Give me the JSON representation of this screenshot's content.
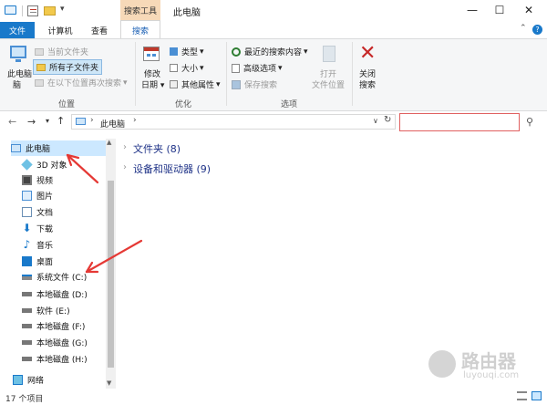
{
  "window": {
    "title": "此电脑",
    "context_tab_group": "搜索工具"
  },
  "tabs": {
    "file": "文件",
    "computer": "计算机",
    "view": "查看",
    "search": "搜索"
  },
  "ribbon": {
    "location": {
      "this_pc": "此电脑",
      "this_pc2": "脑",
      "current_folder": "当前文件夹",
      "all_subfolders": "所有子文件夹",
      "search_again": "在以下位置再次搜索",
      "label": "位置"
    },
    "refine": {
      "modified": "修改",
      "date": "日期",
      "type": "类型",
      "size": "大小",
      "other_props": "其他属性",
      "label": "优化"
    },
    "options": {
      "recent_searches": "最近的搜索内容",
      "advanced": "高级选项",
      "save_search": "保存搜索",
      "open_location_1": "打开",
      "open_location_2": "文件位置",
      "label": "选项"
    },
    "close": {
      "line1": "关闭",
      "line2": "搜索"
    }
  },
  "navbar": {
    "breadcrumb": "此电脑",
    "search_placeholder": ""
  },
  "nav_pane": [
    {
      "label": "此电脑",
      "icon": "computer-icon"
    },
    {
      "label": "3D 对象",
      "icon": "3d-objects-icon"
    },
    {
      "label": "视频",
      "icon": "video-icon"
    },
    {
      "label": "图片",
      "icon": "pictures-icon"
    },
    {
      "label": "文档",
      "icon": "documents-icon"
    },
    {
      "label": "下载",
      "icon": "download-icon"
    },
    {
      "label": "音乐",
      "icon": "music-icon"
    },
    {
      "label": "桌面",
      "icon": "desktop-icon"
    },
    {
      "label": "系统文件 (C:)",
      "icon": "system-drive-icon"
    },
    {
      "label": "本地磁盘 (D:)",
      "icon": "drive-icon"
    },
    {
      "label": "软件 (E:)",
      "icon": "drive-icon"
    },
    {
      "label": "本地磁盘 (F:)",
      "icon": "drive-icon"
    },
    {
      "label": "本地磁盘 (G:)",
      "icon": "drive-icon"
    },
    {
      "label": "本地磁盘 (H:)",
      "icon": "drive-icon"
    },
    {
      "label": "网络",
      "icon": "network-icon"
    }
  ],
  "content": {
    "folders": "文件夹 (8)",
    "devices": "设备和驱动器 (9)"
  },
  "status": {
    "count": "17 个项目"
  },
  "watermark": {
    "brand": "路由器",
    "url": "luyouqi.com"
  },
  "colors": {
    "file_tab": "#1979ca",
    "selected_nav": "#cce8ff",
    "context_tab": "#f7d9b8",
    "search_highlight": "#e06060",
    "annotation_arrow": "#e53935"
  }
}
